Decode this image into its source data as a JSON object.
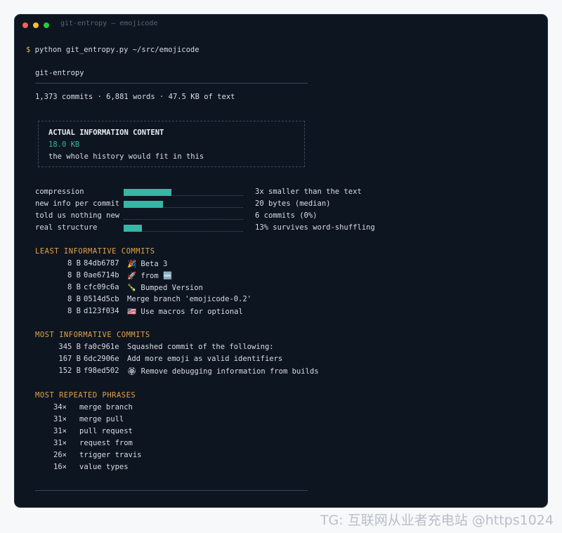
{
  "window": {
    "title": "git-entropy — emojicode"
  },
  "command": {
    "prompt": "$",
    "text": "python git_entropy.py ~/src/emojicode"
  },
  "header": {
    "title": "git-entropy",
    "stats": "1,373 commits · 6,881 words · 47.5 KB of text"
  },
  "info_box": {
    "heading": "ACTUAL INFORMATION CONTENT",
    "value": "18.0 KB",
    "note": "the whole history would fit in this"
  },
  "metrics": [
    {
      "label": "compression",
      "fill": 0.4,
      "desc": "3x smaller than the text"
    },
    {
      "label": "new info per commit",
      "fill": 0.33,
      "desc": "20 bytes (median)"
    },
    {
      "label": "told us nothing new",
      "fill": 0.0,
      "desc": "6 commits (0%)"
    },
    {
      "label": "real structure",
      "fill": 0.15,
      "desc": "13% survives word-shuffling"
    }
  ],
  "least": {
    "heading": "LEAST INFORMATIVE COMMITS",
    "rows": [
      {
        "size": "8 B",
        "hash": "84db6787",
        "msg": "🎉 Beta 3"
      },
      {
        "size": "8 B",
        "hash": "0ae6714b",
        "msg": "🚀 from 🆕"
      },
      {
        "size": "8 B",
        "hash": "cfc09c6a",
        "msg": "🍾 Bumped Version"
      },
      {
        "size": "8 B",
        "hash": "0514d5cb",
        "msg": "Merge branch 'emojicode-0.2'"
      },
      {
        "size": "8 B",
        "hash": "d123f034",
        "msg": "🇺🇸 Use macros for optional"
      }
    ]
  },
  "most": {
    "heading": "MOST INFORMATIVE COMMITS",
    "rows": [
      {
        "size": "345 B",
        "hash": "fa0c961e",
        "msg": "Squashed commit of the following:"
      },
      {
        "size": "167 B",
        "hash": "6dc2906e",
        "msg": "Add more emoji as valid identifiers"
      },
      {
        "size": "152 B",
        "hash": "f98ed502",
        "msg": "🏵 Remove debugging information from builds"
      }
    ]
  },
  "phrases": {
    "heading": "MOST REPEATED PHRASES",
    "rows": [
      {
        "count": "34×",
        "phrase": "merge branch"
      },
      {
        "count": "31×",
        "phrase": "merge pull"
      },
      {
        "count": "31×",
        "phrase": "pull request"
      },
      {
        "count": "31×",
        "phrase": "request from"
      },
      {
        "count": "26×",
        "phrase": "trigger travis"
      },
      {
        "count": "16×",
        "phrase": "value types"
      }
    ]
  },
  "watermark": "TG: 互联网从业者充电站 @https1024",
  "colors": {
    "accent": "#37b5a5",
    "section": "#e3a148",
    "background": "#0d1520"
  }
}
